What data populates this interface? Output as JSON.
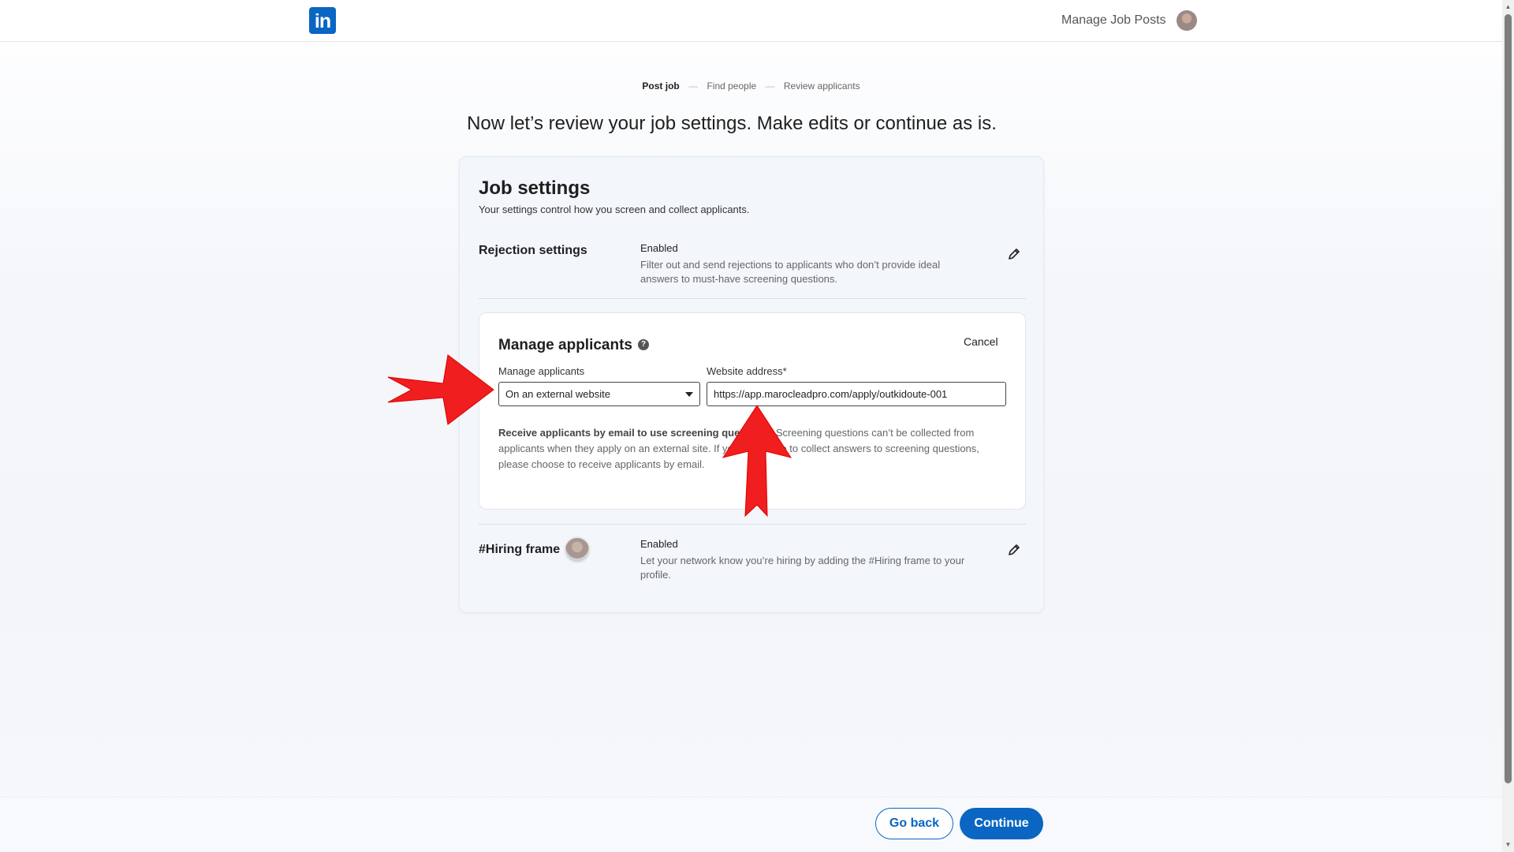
{
  "header": {
    "logo_text": "in",
    "manage_job_posts": "Manage Job Posts"
  },
  "stepper": {
    "steps": [
      "Post job",
      "Find people",
      "Review applicants"
    ],
    "active_step": "Post job"
  },
  "headline": "Now let’s review your job settings. Make edits or continue as is.",
  "card": {
    "title": "Job settings",
    "subtitle": "Your settings control how you screen and collect applicants.",
    "rejection": {
      "title": "Rejection settings",
      "status": "Enabled",
      "description": "Filter out and send rejections to applicants who don’t provide ideal answers to must-have screening questions."
    },
    "manage_applicants": {
      "title": "Manage applicants",
      "cancel_label": "Cancel",
      "select_label": "Manage applicants",
      "select_value": "On an external website",
      "url_label": "Website address*",
      "url_value": "https://app.marocleadpro.com/apply/outkidoute-001",
      "info_bold": "Receive applicants by email to use screening questions.",
      "info_rest": " Screening questions can’t be collected from applicants when they apply on an external site. If you would like to collect answers to screening questions, please choose to receive applicants by email."
    },
    "hiring_frame": {
      "title": "#Hiring frame",
      "status": "Enabled",
      "description": "Let your network know you’re hiring by adding the #Hiring frame to your profile."
    }
  },
  "footer": {
    "back_label": "Go back",
    "continue_label": "Continue"
  },
  "colors": {
    "brand": "#0a66c2",
    "annotation": "#f01e1e"
  }
}
